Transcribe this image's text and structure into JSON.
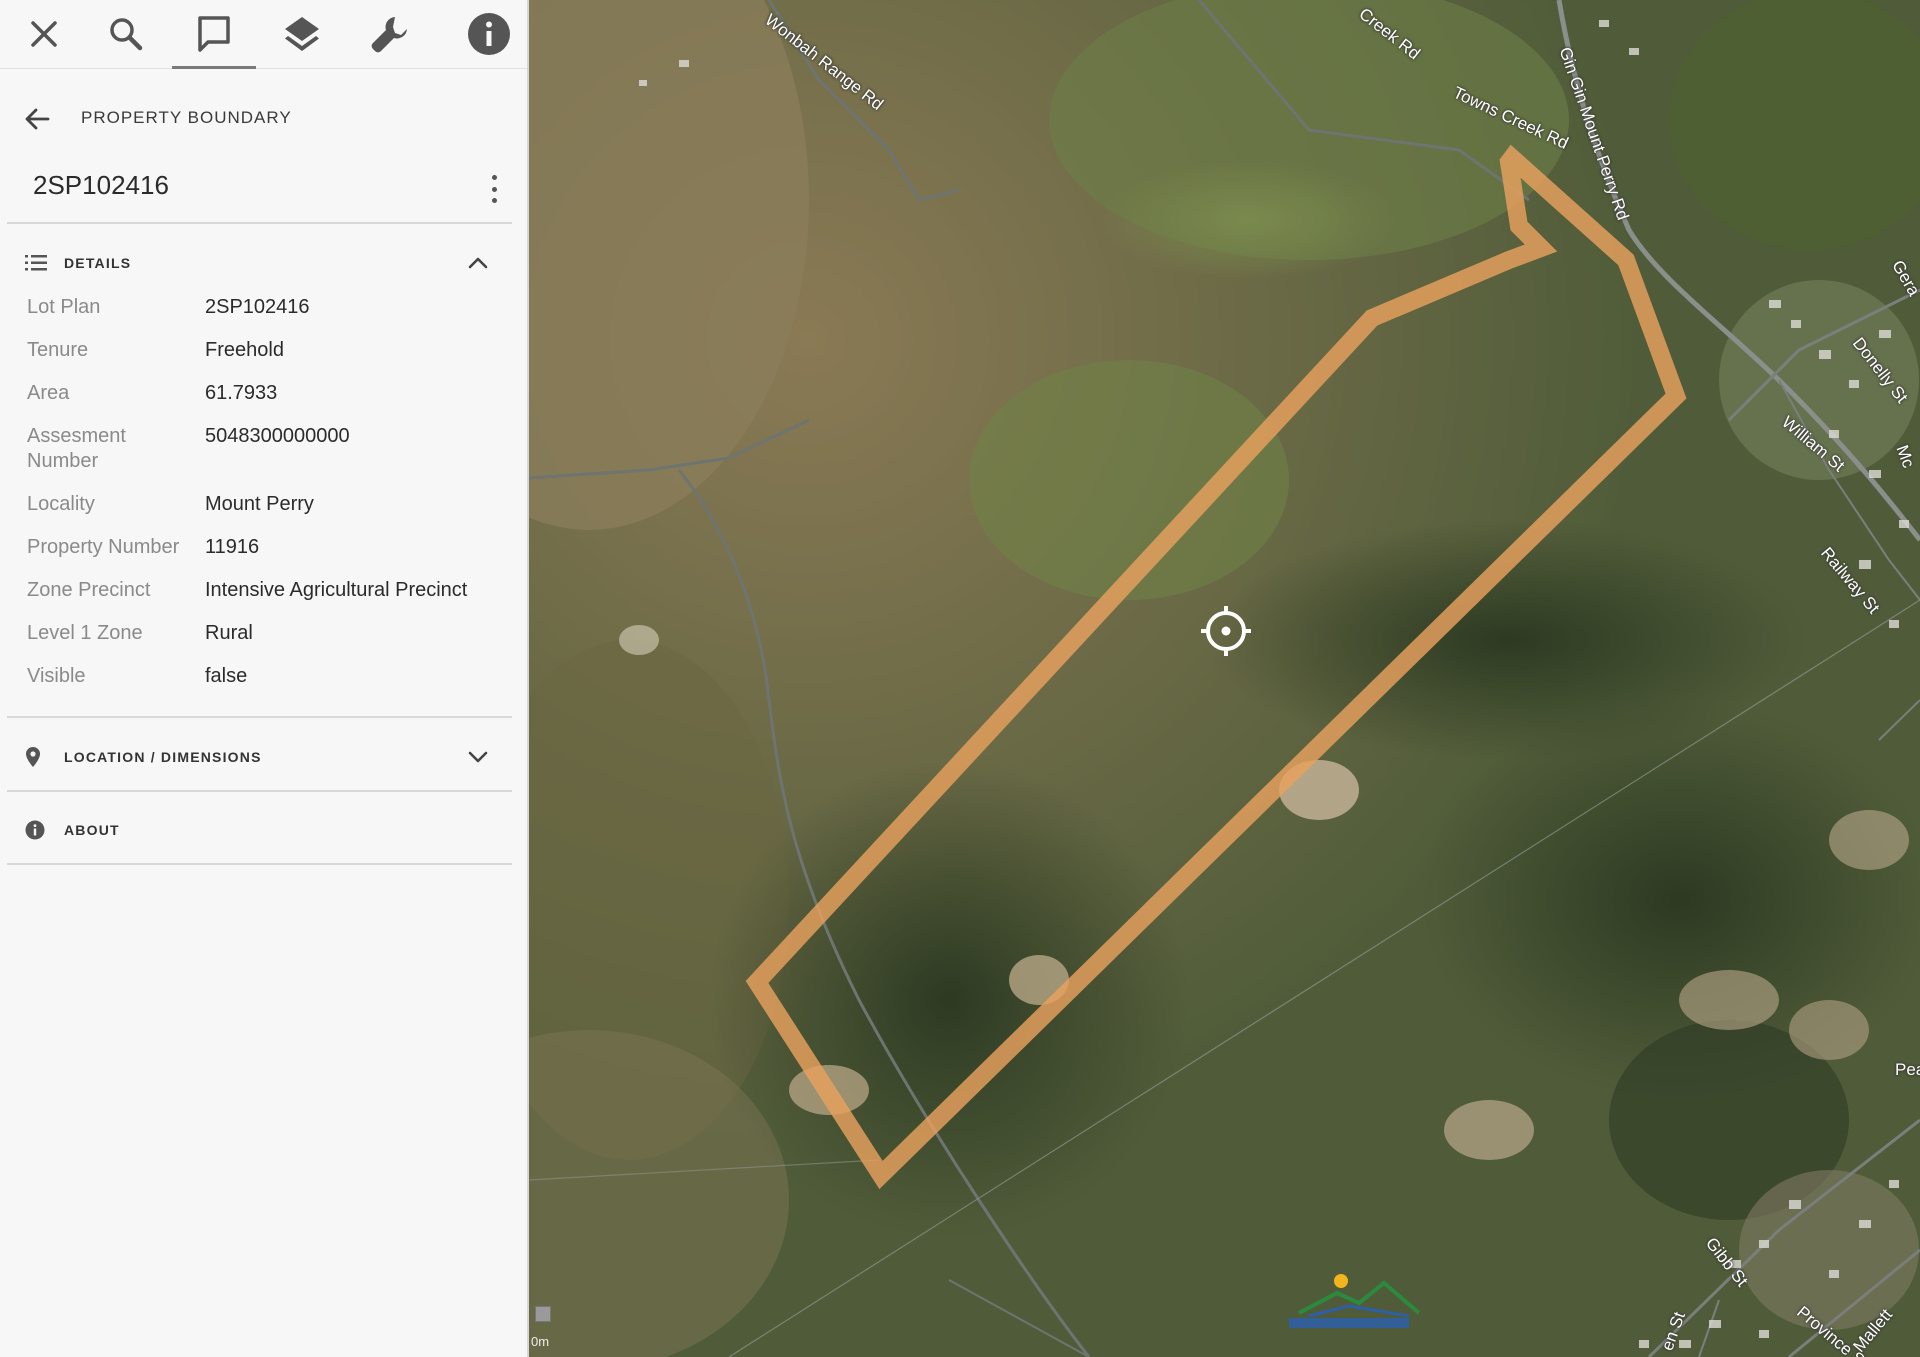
{
  "toolbar": {
    "buttons": [
      {
        "name": "close",
        "icon": "close-icon"
      },
      {
        "name": "search",
        "icon": "search-icon"
      },
      {
        "name": "feature-info",
        "icon": "comment-icon",
        "active": true
      },
      {
        "name": "layers",
        "icon": "layers-icon"
      },
      {
        "name": "tools",
        "icon": "wrench-icon"
      },
      {
        "name": "about",
        "icon": "info-icon"
      }
    ]
  },
  "header": {
    "section": "PROPERTY BOUNDARY",
    "feature_title": "2SP102416"
  },
  "panels": {
    "details": {
      "label": "DETAILS",
      "expanded": true,
      "rows": [
        {
          "label": "Lot Plan",
          "value": "2SP102416"
        },
        {
          "label": "Tenure",
          "value": "Freehold"
        },
        {
          "label": "Area",
          "value": "61.7933"
        },
        {
          "label": "Assesment Number",
          "value": "5048300000000"
        },
        {
          "label": "Locality",
          "value": "Mount Perry"
        },
        {
          "label": "Property Number",
          "value": "11916"
        },
        {
          "label": "Zone Precinct",
          "value": "Intensive Agricultural Precinct"
        },
        {
          "label": "Level 1 Zone",
          "value": "Rural"
        },
        {
          "label": "Visible",
          "value": "false"
        }
      ]
    },
    "location": {
      "label": "LOCATION / DIMENSIONS",
      "expanded": false
    },
    "about": {
      "label": "ABOUT"
    }
  },
  "map": {
    "road_labels": [
      "Wonbah Range Rd",
      "Creek Rd",
      "Towns Creek Rd",
      "Gin Gin Mount Perry Rd",
      "William St",
      "Donelly St",
      "Railway St",
      "Gibb St",
      "Province St",
      "Mallett",
      "Gera",
      "Mc",
      "Pea",
      "en St"
    ],
    "scale_text": "0m",
    "boundary_color": "#e8a15e"
  }
}
